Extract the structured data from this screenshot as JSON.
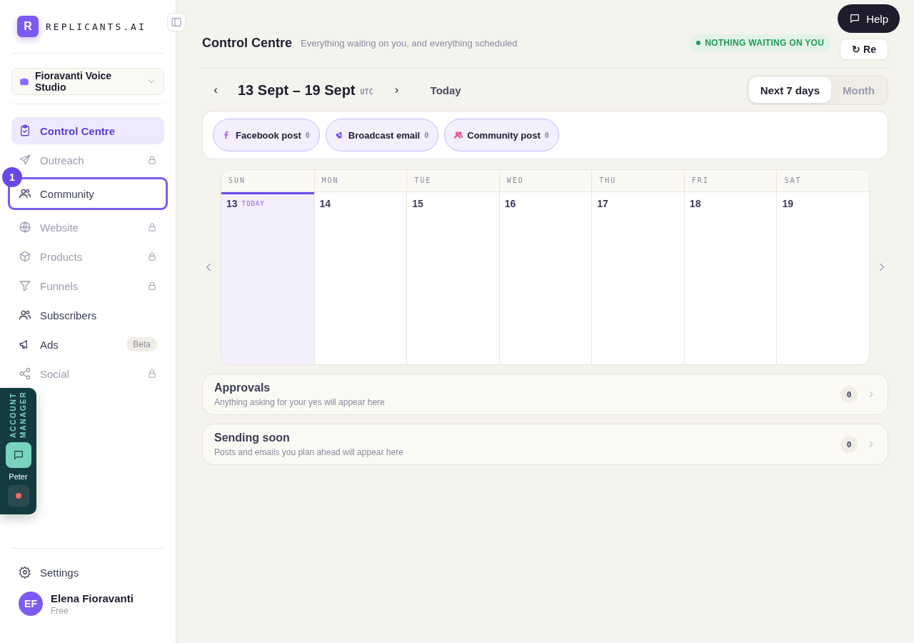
{
  "brand": {
    "logo": "R",
    "name": "REPLICANTS.AI"
  },
  "workspace": {
    "name": "Fioravanti Voice Studio"
  },
  "nav": [
    {
      "label": "Control Centre",
      "kind": "normal",
      "selected": true
    },
    {
      "label": "Outreach",
      "kind": "locked",
      "selected": false
    },
    {
      "label": "Community",
      "kind": "normal",
      "selected": false,
      "callout": "1"
    },
    {
      "label": "Website",
      "kind": "locked",
      "selected": false
    },
    {
      "label": "Products",
      "kind": "locked",
      "selected": false
    },
    {
      "label": "Funnels",
      "kind": "locked",
      "selected": false
    },
    {
      "label": "Subscribers",
      "kind": "normal",
      "selected": false
    },
    {
      "label": "Ads",
      "kind": "beta",
      "selected": false,
      "badge": "Beta"
    },
    {
      "label": "Social",
      "kind": "locked",
      "selected": false
    }
  ],
  "account_manager": {
    "title": "ACCOUNT MANAGER",
    "name": "Peter"
  },
  "settings": {
    "label": "Settings"
  },
  "user": {
    "initials": "EF",
    "name": "Elena Fioravanti",
    "plan": "Free"
  },
  "header": {
    "title": "Control Centre",
    "subtitle": "Everything waiting on you, and everything scheduled",
    "status": "NOTHING WAITING ON YOU",
    "refresh": "↻ Re",
    "help": "Help"
  },
  "range": {
    "prev": "‹",
    "label": "13 Sept – 19 Sept",
    "tz": "UTC",
    "next": "›",
    "today": "Today"
  },
  "views": [
    {
      "label": "Next 7 days",
      "selected": true
    },
    {
      "label": "Month",
      "selected": false
    }
  ],
  "filters": [
    {
      "label": "Facebook post",
      "count": "0",
      "color": "#a855f7"
    },
    {
      "label": "Broadcast email",
      "count": "0",
      "color": "#6d4ee8"
    },
    {
      "label": "Community post",
      "count": "0",
      "color": "#e0457b"
    }
  ],
  "calendar": {
    "days": [
      {
        "weekday": "SUN",
        "date": "13",
        "today_label": "TODAY",
        "selected": true
      },
      {
        "weekday": "MON",
        "date": "14",
        "selected": false
      },
      {
        "weekday": "TUE",
        "date": "15",
        "selected": false
      },
      {
        "weekday": "WED",
        "date": "16",
        "selected": false
      },
      {
        "weekday": "THU",
        "date": "17",
        "selected": false
      },
      {
        "weekday": "FRI",
        "date": "18",
        "selected": false
      },
      {
        "weekday": "SAT",
        "date": "19",
        "selected": false
      }
    ]
  },
  "panels": [
    {
      "title": "Approvals",
      "subtitle": "Anything asking for your yes will appear here",
      "count": "0"
    },
    {
      "title": "Sending soon",
      "subtitle": "Posts and emails you plan ahead will appear here",
      "count": "0"
    }
  ]
}
